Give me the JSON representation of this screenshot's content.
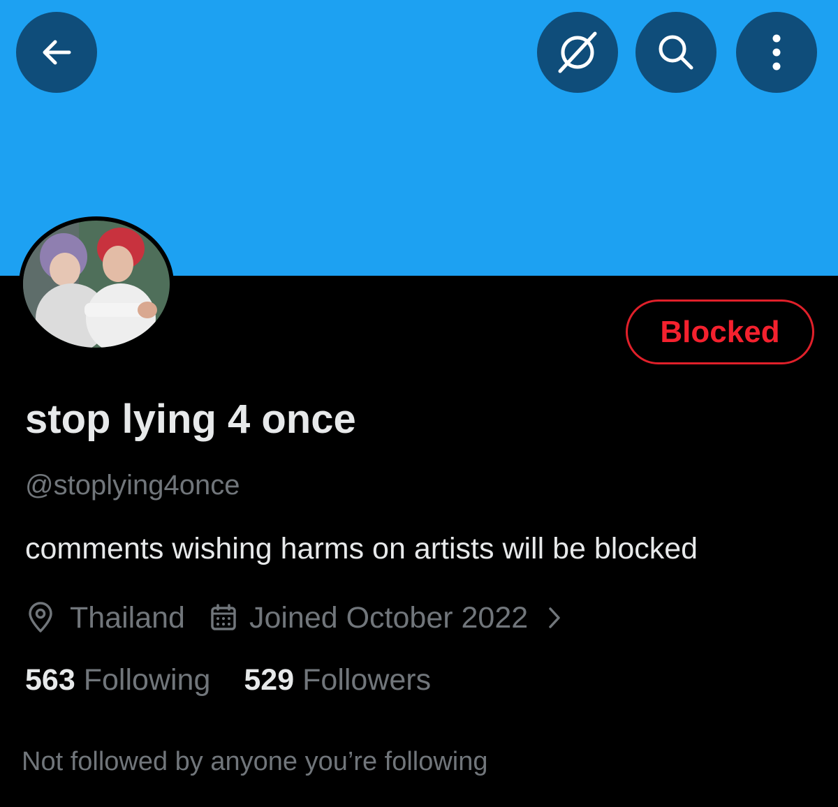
{
  "header": {
    "back_icon": "arrow-left-icon",
    "dismiss_icon": "slash-circle-icon",
    "search_icon": "search-icon",
    "more_icon": "more-vertical-icon",
    "banner_color": "#1da1f2",
    "button_color": "#0f4d7a"
  },
  "profile": {
    "display_name": "stop lying 4 once",
    "handle": "@stoplying4once",
    "bio": "comments wishing harms on artists will be blocked",
    "location": "Thailand",
    "joined": "Joined October 2022",
    "blocked_label": "Blocked",
    "blocked_color": "#f4212e",
    "following_count": "563",
    "following_label": "Following",
    "followers_count": "529",
    "followers_label": "Followers",
    "not_followed_text": "Not followed by anyone you’re following"
  }
}
